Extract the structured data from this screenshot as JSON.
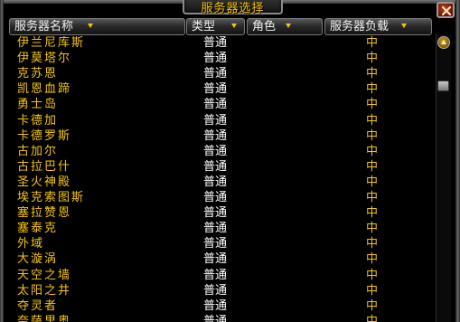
{
  "window": {
    "title": "服务器选择"
  },
  "columns": {
    "name": "服务器名称",
    "type": "类型",
    "role": "角色",
    "load": "服务器负载"
  },
  "icons": {
    "sort": "sort-arrow-icon",
    "close": "close-icon",
    "scroll_up": "scroll-up-arrow-icon"
  },
  "colors": {
    "server_name": "#f5c40c",
    "server_type": "#ffffff",
    "server_load": "#f5c40c",
    "header_text": "#f2f2f2"
  },
  "servers": [
    {
      "name": "伊兰尼库斯",
      "type": "普通",
      "role": "",
      "load": "中"
    },
    {
      "name": "伊莫塔尔",
      "type": "普通",
      "role": "",
      "load": "中"
    },
    {
      "name": "克苏恩",
      "type": "普通",
      "role": "",
      "load": "中"
    },
    {
      "name": "凯恩血蹄",
      "type": "普通",
      "role": "",
      "load": "中"
    },
    {
      "name": "勇士岛",
      "type": "普通",
      "role": "",
      "load": "中"
    },
    {
      "name": "卡德加",
      "type": "普通",
      "role": "",
      "load": "中"
    },
    {
      "name": "卡德罗斯",
      "type": "普通",
      "role": "",
      "load": "中"
    },
    {
      "name": "古加尔",
      "type": "普通",
      "role": "",
      "load": "中"
    },
    {
      "name": "古拉巴什",
      "type": "普通",
      "role": "",
      "load": "中"
    },
    {
      "name": "圣火神殿",
      "type": "普通",
      "role": "",
      "load": "中"
    },
    {
      "name": "埃克索图斯",
      "type": "普通",
      "role": "",
      "load": "中"
    },
    {
      "name": "塞拉赞恩",
      "type": "普通",
      "role": "",
      "load": "中"
    },
    {
      "name": "塞泰克",
      "type": "普通",
      "role": "",
      "load": "中"
    },
    {
      "name": "外域",
      "type": "普通",
      "role": "",
      "load": "中"
    },
    {
      "name": "大漩涡",
      "type": "普通",
      "role": "",
      "load": "中"
    },
    {
      "name": "天空之墙",
      "type": "普通",
      "role": "",
      "load": "中"
    },
    {
      "name": "太阳之井",
      "type": "普通",
      "role": "",
      "load": "中"
    },
    {
      "name": "夺灵者",
      "type": "普通",
      "role": "",
      "load": "中"
    },
    {
      "name": "奈萨里奥",
      "type": "普通",
      "role": "",
      "load": "中"
    }
  ]
}
